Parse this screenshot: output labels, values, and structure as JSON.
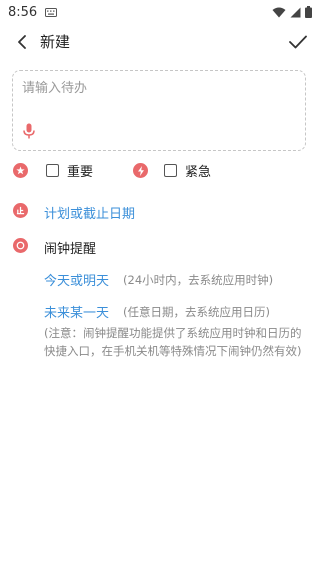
{
  "status": {
    "time": "8:56"
  },
  "header": {
    "title": "新建"
  },
  "input": {
    "placeholder": "请输入待办"
  },
  "priority": {
    "important_label": "重要",
    "urgent_label": "紧急"
  },
  "deadline": {
    "label": "计划或截止日期"
  },
  "alarm": {
    "title": "闹钟提醒",
    "option1_label": "今天或明天",
    "option1_hint": "(24小时内，去系统应用时钟)",
    "option2_label": "未来某一天",
    "option2_hint": "(任意日期，去系统应用日历)",
    "note": "(注意：闹钟提醒功能提供了系统应用时钟和日历的快捷入口，在手机关机等特殊情况下闹钟仍然有效)"
  },
  "colors": {
    "accent_red": "#e9696b",
    "link_blue": "#3b8fd9"
  }
}
